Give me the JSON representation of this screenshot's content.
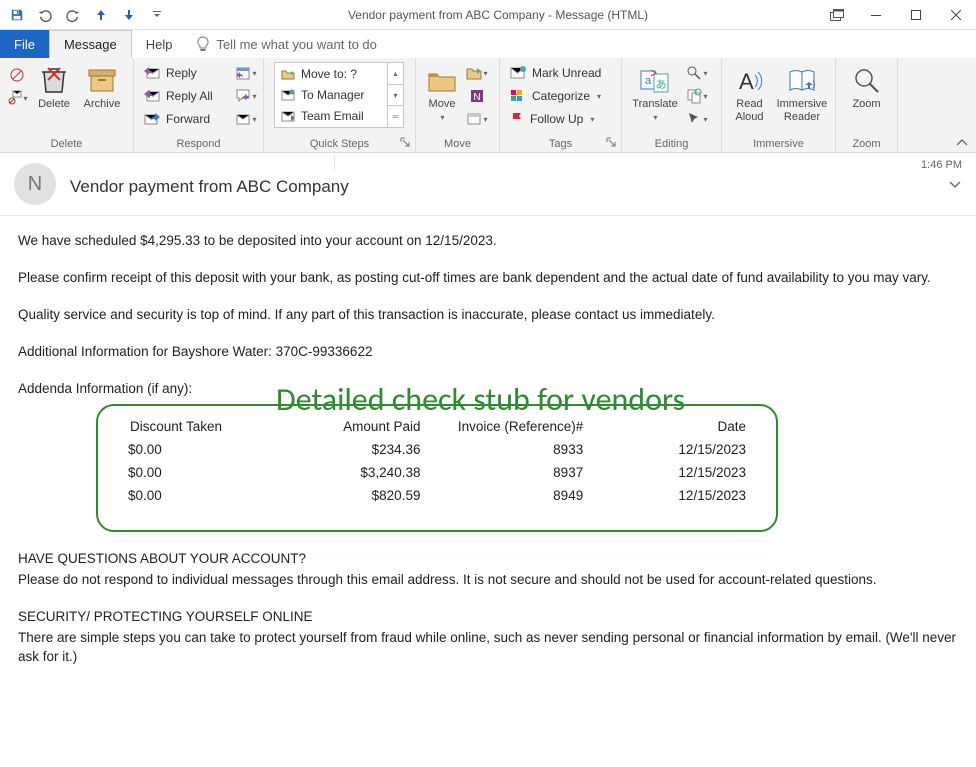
{
  "window": {
    "title": "Vendor payment from ABC Company  -  Message (HTML)"
  },
  "qat": {
    "customize_tooltip": "Customize Quick Access Toolbar"
  },
  "tabs": {
    "file": "File",
    "message": "Message",
    "help": "Help",
    "tellme": "Tell me what you want to do"
  },
  "ribbon": {
    "delete_group": "Delete",
    "delete": "Delete",
    "archive": "Archive",
    "respond_group": "Respond",
    "reply": "Reply",
    "reply_all": "Reply All",
    "forward": "Forward",
    "quick_steps_group": "Quick Steps",
    "qs_move_to": "Move to: ?",
    "qs_to_manager": "To Manager",
    "qs_team_email": "Team Email",
    "move_group": "Move",
    "move": "Move",
    "tags_group": "Tags",
    "mark_unread": "Mark Unread",
    "categorize": "Categorize",
    "follow_up": "Follow Up",
    "editing_group": "Editing",
    "translate": "Translate",
    "immersive_group": "Immersive",
    "read_aloud": "Read\nAloud",
    "immersive_reader": "Immersive\nReader",
    "zoom_group": "Zoom",
    "zoom": "Zoom"
  },
  "header": {
    "avatar_initial": "N",
    "subject": "Vendor payment from ABC Company",
    "time": "1:46 PM"
  },
  "body": {
    "p1": "We have scheduled $4,295.33 to be deposited into your account on 12/15/2023.",
    "p2": "Please confirm receipt of this deposit with your bank, as posting cut-off times are bank dependent and the actual date of fund availability to you may vary.",
    "p3": "Quality service and security is top of mind. If any part of this transaction is inaccurate, please contact us immediately.",
    "p4": "Additional Information for Bayshore Water: 370C-99336622",
    "p5": "Addenda Information (if any):",
    "q_heading": "HAVE QUESTIONS ABOUT YOUR ACCOUNT?",
    "q_text": "Please do not respond to individual messages through this email address. It is not secure and should not be used for account-related questions.",
    "s_heading": "SECURITY/ PROTECTING YOURSELF ONLINE",
    "s_text": "There are simple steps you can take to protect yourself from fraud while online, such as never sending personal or financial information by email. (We'll never ask for it.)"
  },
  "annotation": "Detailed check stub for vendors",
  "stub": {
    "headers": {
      "discount": "Discount Taken",
      "amount": "Amount Paid",
      "invoice": "Invoice (Reference)#",
      "date": "Date"
    },
    "rows": [
      {
        "discount": "$0.00",
        "amount": "$234.36",
        "invoice": "8933",
        "date": "12/15/2023"
      },
      {
        "discount": "$0.00",
        "amount": "$3,240.38",
        "invoice": "8937",
        "date": "12/15/2023"
      },
      {
        "discount": "$0.00",
        "amount": "$820.59",
        "invoice": "8949",
        "date": "12/15/2023"
      }
    ]
  }
}
